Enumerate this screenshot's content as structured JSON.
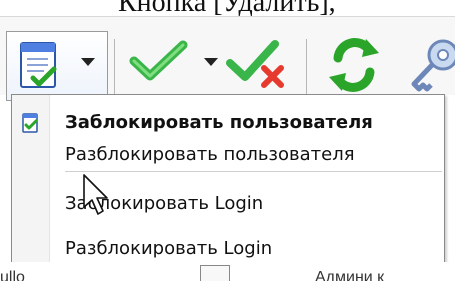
{
  "document": {
    "caption": "Кнопка [Удалить],"
  },
  "toolbar": {
    "buttons": [
      {
        "icon": "document-check-icon",
        "has_dropdown": true
      },
      {
        "icon": "green-check-icon",
        "has_dropdown": true
      },
      {
        "icon": "check-cross-icon",
        "has_dropdown": false
      },
      {
        "icon": "refresh-icon",
        "has_dropdown": false
      },
      {
        "icon": "key-icon",
        "has_dropdown": false
      }
    ]
  },
  "menu": {
    "items": [
      {
        "label": "Заблокировать пользователя",
        "bold": true,
        "icon": "document-check-icon"
      },
      {
        "label": "Разблокировать пользователя",
        "bold": false
      },
      {
        "label": "Заблокировать Login",
        "bold": false
      },
      {
        "label": "Разблокировать Login",
        "bold": false
      }
    ]
  },
  "table_fragment": {
    "left_text": "ullo",
    "right_text": "Админи к"
  },
  "colors": {
    "menu_border": "#8a8a8a",
    "accent_green": "#2aa52a",
    "accent_red": "#d6352d",
    "button_frame": "#9a9a9a"
  }
}
